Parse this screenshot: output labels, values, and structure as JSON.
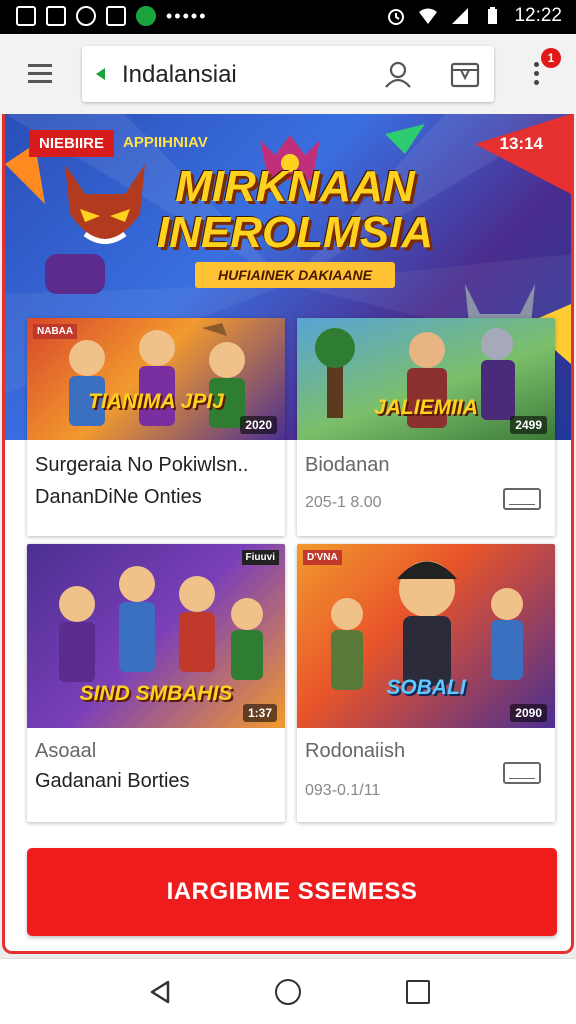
{
  "status_bar": {
    "time": "12:22",
    "left_icons": [
      "screenshot-icon",
      "image-icon",
      "whatsapp-icon",
      "gallery-icon",
      "app-icon"
    ],
    "right_icons": [
      "alarm-icon",
      "wifi-icon",
      "signal-icon",
      "battery-icon"
    ]
  },
  "app_bar": {
    "menu_icon": "hamburger-menu-icon",
    "search_text": "Indalansiai",
    "icons": [
      "person-icon",
      "card-icon",
      "more-vert-icon"
    ],
    "notification_count": "1"
  },
  "banner": {
    "tag": "NIEBIIRE",
    "subtitle": "APPIIHNIAV",
    "count": "13:14",
    "title_line1": "MIRKNAAN",
    "title_line2": "INEROLMSIA",
    "strapline": "HUFIAINEK DAKIAANE"
  },
  "cards": [
    {
      "thumb_tag": "NABAA",
      "thumb_title": "TIANIMA JPIJ",
      "thumb_badge": "2020",
      "line1": "Surgeraia No Pokiwlsn..",
      "line2": "DananDiNe Onties",
      "style": "dark"
    },
    {
      "thumb_tag": "",
      "thumb_title": "JALIEMIIA",
      "thumb_badge": "2499",
      "line1": "Biodanan",
      "line2": "205-1 8.00",
      "style": "gray"
    },
    {
      "thumb_tag": "Fiuuvi",
      "thumb_title": "SIND SMBAHIS",
      "thumb_badge": "1:37",
      "line1": "Asoaal",
      "line2": "Gadanani Borties",
      "style": "mixed"
    },
    {
      "thumb_tag": "D'VNA",
      "thumb_title": "SOBALI",
      "thumb_badge": "2090",
      "line1": "Rodonaiish",
      "line2": "093-0.1/11",
      "style": "gray"
    }
  ],
  "cta": {
    "label": "IARGIBME SSEMESS"
  },
  "nav_bar": {
    "icons": [
      "back-icon",
      "home-icon",
      "recents-icon"
    ]
  }
}
